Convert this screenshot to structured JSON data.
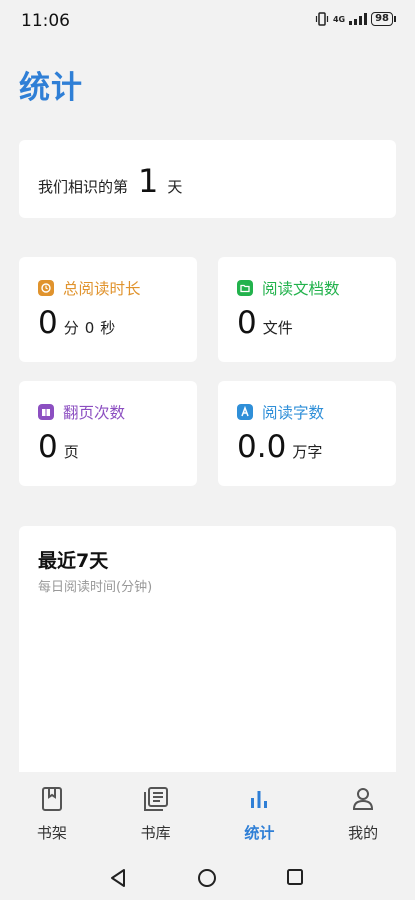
{
  "status_bar": {
    "time": "11:06",
    "network": "4G",
    "battery": "98"
  },
  "page": {
    "title": "统计"
  },
  "days": {
    "prefix": "我们相识的第",
    "count": "1",
    "suffix": "天"
  },
  "stats": [
    {
      "label": "总阅读时长",
      "value": "0",
      "unit1": "分",
      "value2": "0",
      "unit2": "秒",
      "color": "#e0932d",
      "icon": "clock-icon"
    },
    {
      "label": "阅读文档数",
      "value": "0",
      "unit1": "文件",
      "color": "#22b24c",
      "icon": "folder-icon"
    },
    {
      "label": "翻页次数",
      "value": "0",
      "unit1": "页",
      "color": "#8c4fc1",
      "icon": "book-open-icon"
    },
    {
      "label": "阅读字数",
      "value": "0.0",
      "unit1": "万字",
      "color": "#2f8fd8",
      "icon": "letter-a-icon"
    }
  ],
  "recent": {
    "title": "最近7天",
    "subtitle": "每日阅读时间(分钟)"
  },
  "nav": [
    {
      "label": "书架",
      "icon": "bookmark-book-icon"
    },
    {
      "label": "书库",
      "icon": "library-icon"
    },
    {
      "label": "统计",
      "icon": "bar-chart-icon",
      "active": true
    },
    {
      "label": "我的",
      "icon": "user-icon"
    }
  ],
  "colors": {
    "accent": "#2f7fd6",
    "background": "#f2f2f2"
  }
}
